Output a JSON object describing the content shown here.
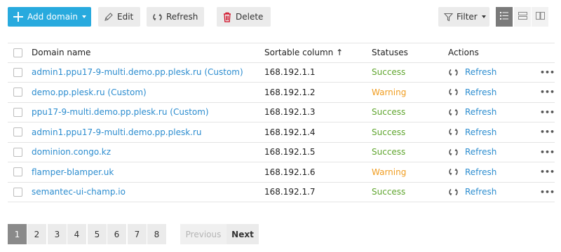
{
  "toolbar": {
    "add_domain_label": "Add domain",
    "edit_label": "Edit",
    "refresh_label": "Refresh",
    "delete_label": "Delete",
    "filter_label": "Filter"
  },
  "table": {
    "headers": {
      "domain": "Domain name",
      "sortable": "Sortable column ↑",
      "statuses": "Statuses",
      "actions": "Actions"
    },
    "rows": [
      {
        "domain": "admin1.ppu17-9-multi.demo.pp.plesk.ru (Custom)",
        "ip": "168.192.1.1",
        "status": "Success",
        "action": "Refresh",
        "more": "•••"
      },
      {
        "domain": "demo.pp.plesk.ru (Custom)",
        "ip": "168.192.1.2",
        "status": "Warning",
        "action": "Refresh",
        "more": "•••"
      },
      {
        "domain": "ppu17-9-multi.demo.pp.plesk.ru (Custom)",
        "ip": "168.192.1.3",
        "status": "Success",
        "action": "Refresh",
        "more": "•••"
      },
      {
        "domain": "admin1.ppu17-9-multi.demo.pp.plesk.ru",
        "ip": "168.192.1.4",
        "status": "Success",
        "action": "Refresh",
        "more": "•••"
      },
      {
        "domain": "dominion.congo.kz",
        "ip": "168.192.1.5",
        "status": "Success",
        "action": "Refresh",
        "more": "•••"
      },
      {
        "domain": "flamper-blamper.uk",
        "ip": "168.192.1.6",
        "status": "Warning",
        "action": "Refresh",
        "more": "•••"
      },
      {
        "domain": "semantec-ui-champ.io",
        "ip": "168.192.1.7",
        "status": "Success",
        "action": "Refresh",
        "more": "•••"
      }
    ]
  },
  "pagination": {
    "pages": [
      "1",
      "2",
      "3",
      "4",
      "5",
      "6",
      "7",
      "8"
    ],
    "current": "1",
    "previous_label": "Previous",
    "next_label": "Next"
  },
  "colors": {
    "primary": "#28aade",
    "link": "#2b8ccf",
    "success": "#5fa52e",
    "warning": "#f09c1f"
  },
  "icons": {
    "add": "plus-icon",
    "edit": "pencil-icon",
    "refresh": "refresh-icon",
    "delete": "trash-icon",
    "filter": "funnel-icon",
    "view_list": "list-view-icon",
    "view_tiles": "tiles-view-icon",
    "view_cards": "cards-view-icon",
    "row_more": "more-icon"
  }
}
